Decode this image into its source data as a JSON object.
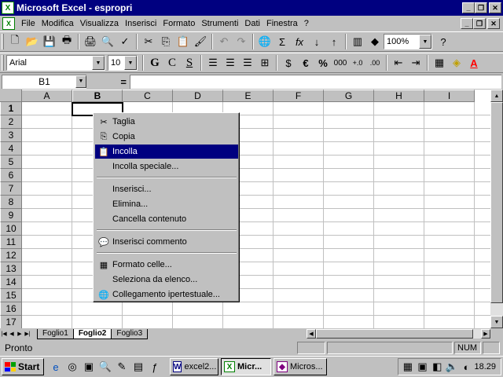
{
  "window": {
    "title": "Microsoft Excel - espropri"
  },
  "menubar": {
    "items": [
      "File",
      "Modifica",
      "Visualizza",
      "Inserisci",
      "Formato",
      "Strumenti",
      "Dati",
      "Finestra",
      "?"
    ]
  },
  "toolbar": {
    "zoom": "100%"
  },
  "format_toolbar": {
    "font": "Arial",
    "size": "10",
    "bold": "G",
    "italic": "C",
    "underline": "S",
    "currency": "€",
    "percent": "%",
    "thousands": "000"
  },
  "formula_bar": {
    "name_box": "B1",
    "equals": "="
  },
  "grid": {
    "columns": [
      "A",
      "B",
      "C",
      "D",
      "E",
      "F",
      "G",
      "H",
      "I"
    ],
    "rows": [
      "1",
      "2",
      "3",
      "4",
      "5",
      "6",
      "7",
      "8",
      "9",
      "10",
      "11",
      "12",
      "13",
      "14",
      "15",
      "16",
      "17"
    ],
    "active_column": "B",
    "active_row": "1"
  },
  "context_menu": {
    "items": [
      {
        "label": "Taglia",
        "icon": "scissors-icon"
      },
      {
        "label": "Copia",
        "icon": "copy-icon"
      },
      {
        "label": "Incolla",
        "icon": "paste-icon"
      },
      {
        "label": "Incolla speciale...",
        "icon": ""
      },
      {
        "label": "Inserisci...",
        "icon": ""
      },
      {
        "label": "Elimina...",
        "icon": ""
      },
      {
        "label": "Cancella contenuto",
        "icon": ""
      },
      {
        "label": "Inserisci commento",
        "icon": "comment-icon"
      },
      {
        "label": "Formato celle...",
        "icon": "format-cells-icon"
      },
      {
        "label": "Seleziona da elenco...",
        "icon": ""
      },
      {
        "label": "Collegamento ipertestuale...",
        "icon": "hyperlink-icon"
      }
    ],
    "highlighted": "Incolla"
  },
  "sheets": {
    "tabs": [
      "Foglio1",
      "Foglio2",
      "Foglio3"
    ],
    "active": "Foglio2"
  },
  "statusbar": {
    "text": "Pronto",
    "num": "NUM"
  },
  "taskbar": {
    "start": "Start",
    "buttons": [
      "excel2...",
      "Micr...",
      "Micros..."
    ],
    "active_button": "Micr...",
    "clock": "18.29"
  }
}
